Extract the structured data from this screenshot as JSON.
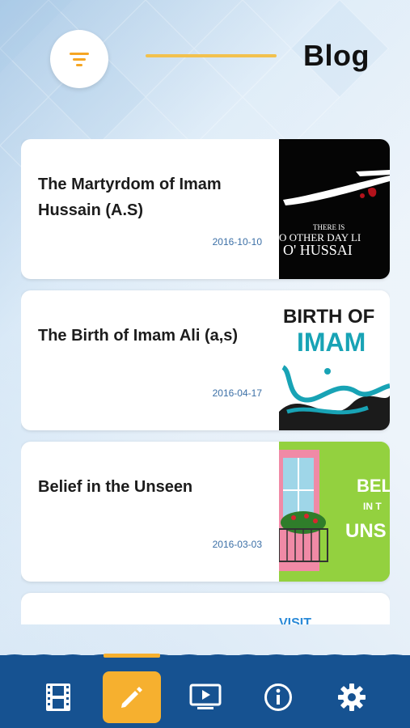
{
  "header": {
    "title": "Blog",
    "filter_icon": "filter-icon"
  },
  "posts": [
    {
      "title": "The Martyrdom of Imam Hussain (A.S)",
      "date": "2016-10-10",
      "thumb_text_line1": "THERE IS",
      "thumb_text_line2": "O OTHER DAY LI",
      "thumb_text_line3": "O' HUSSAI"
    },
    {
      "title": "The Birth of Imam Ali (a,s)",
      "date": "2016-04-17",
      "thumb_text_line1": "BIRTH OF",
      "thumb_text_line2": "IMAM"
    },
    {
      "title": "Belief in the Unseen",
      "date": "2016-03-03",
      "thumb_text_line1": "BEL",
      "thumb_text_line2": "IN T",
      "thumb_text_line3": "UNS"
    },
    {
      "title": "",
      "date": "",
      "thumb_text_line1": "VISIT"
    }
  ],
  "nav": {
    "items": [
      {
        "icon": "film-icon",
        "active": false
      },
      {
        "icon": "pencil-icon",
        "active": true
      },
      {
        "icon": "tv-play-icon",
        "active": false
      },
      {
        "icon": "info-icon",
        "active": false
      },
      {
        "icon": "gear-icon",
        "active": false
      }
    ],
    "bar_color": "#165291",
    "accent_color": "#f6b02f"
  }
}
